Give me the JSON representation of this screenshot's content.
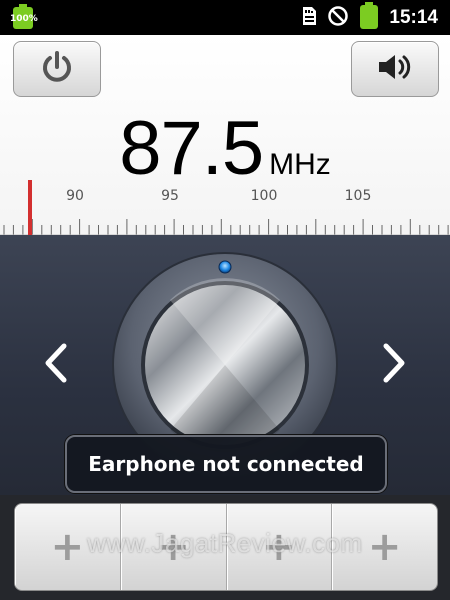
{
  "status_bar": {
    "battery_small_label": "100%",
    "time": "15:14",
    "icons": [
      "battery-small-icon",
      "sd-card-icon",
      "no-sign-icon",
      "battery-icon"
    ]
  },
  "radio": {
    "frequency": "87.5",
    "unit": "MHz",
    "scale_labels": [
      "90",
      "95",
      "100",
      "105"
    ],
    "power_icon": "power-icon",
    "volume_icon": "speaker-icon",
    "accent_color": "#d32f2f",
    "led_color": "#1e88e5"
  },
  "toast": {
    "message": "Earphone not connected"
  },
  "presets": [
    {
      "label": "+"
    },
    {
      "label": "+"
    },
    {
      "label": "+"
    },
    {
      "label": "+"
    }
  ],
  "watermark": "www.JagatReview.com"
}
